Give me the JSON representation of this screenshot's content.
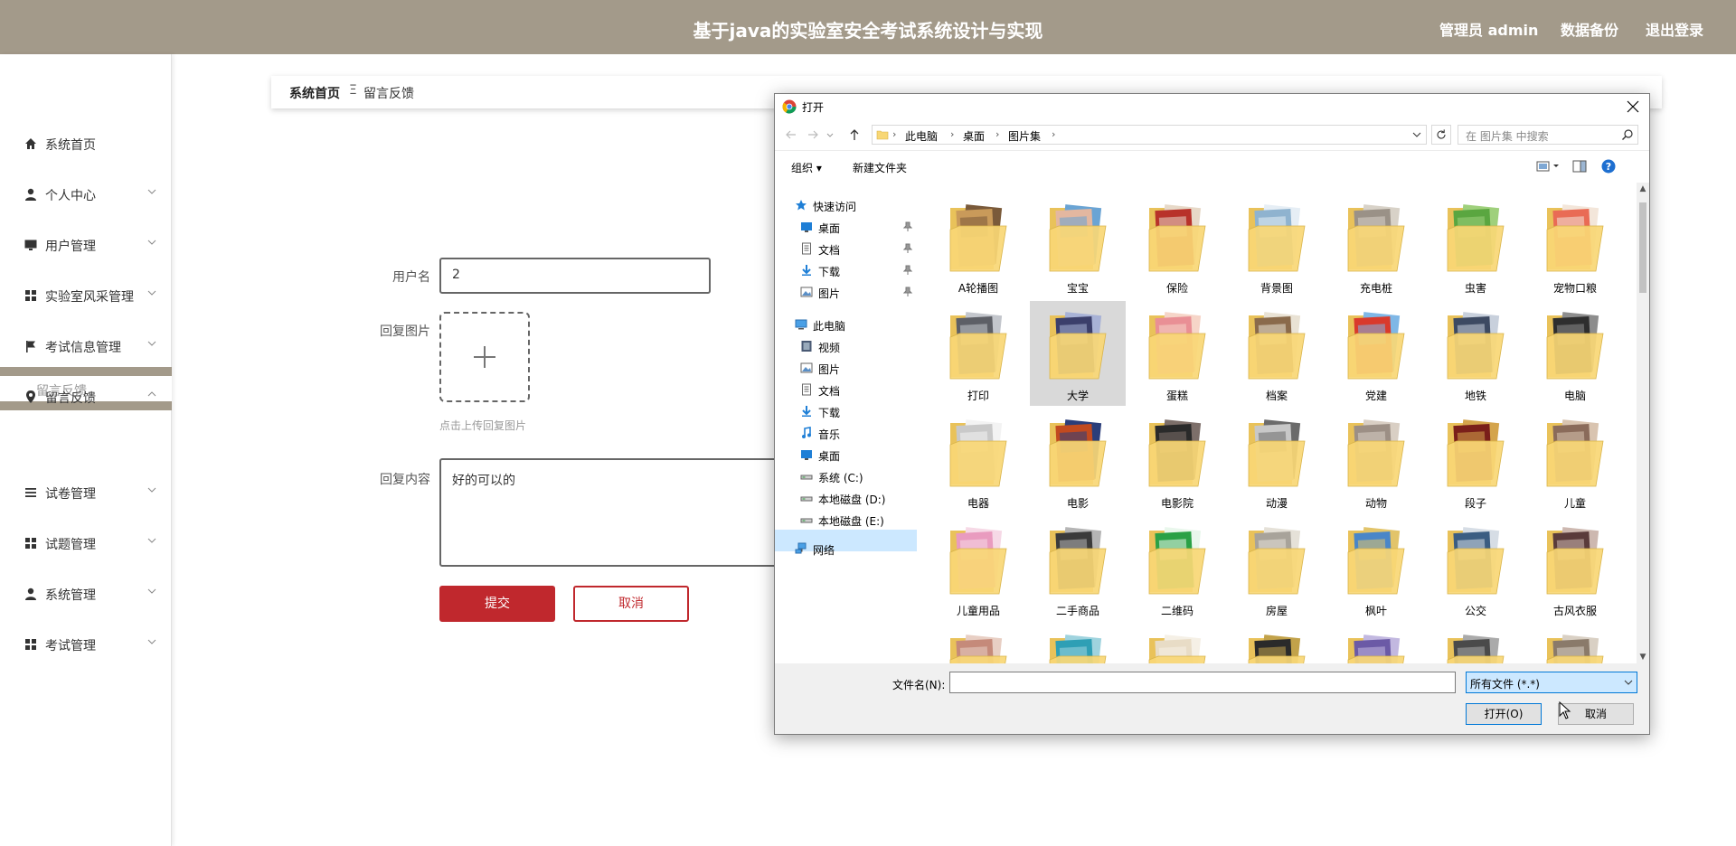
{
  "header": {
    "title": "基于java的实验室安全考试系统设计与实现",
    "admin_label": "管理员 admin",
    "backup_label": "数据备份",
    "logout_label": "退出登录"
  },
  "sidebar": {
    "items": [
      {
        "label": "系统首页",
        "icon": "home-icon"
      },
      {
        "label": "个人中心",
        "icon": "user-icon"
      },
      {
        "label": "用户管理",
        "icon": "monitor-icon"
      },
      {
        "label": "实验室风采管理",
        "icon": "grid-icon"
      },
      {
        "label": "考试信息管理",
        "icon": "flag-icon"
      },
      {
        "label": "留言反馈",
        "icon": "location-pin-icon"
      },
      {
        "label": "试卷管理",
        "icon": "list-icon"
      },
      {
        "label": "试题管理",
        "icon": "grid-icon"
      },
      {
        "label": "系统管理",
        "icon": "user-icon"
      },
      {
        "label": "考试管理",
        "icon": "grid-icon"
      }
    ],
    "active_sub": "留言反馈"
  },
  "breadcrumb": {
    "home": "系统首页",
    "separator": "Ξ",
    "current": "留言反馈"
  },
  "form": {
    "username_label": "用户名",
    "username_value": "2",
    "image_label": "回复图片",
    "upload_hint": "点击上传回复图片",
    "content_label": "回复内容",
    "content_value": "好的可以的",
    "submit_label": "提交",
    "cancel_label": "取消"
  },
  "dialog": {
    "title": "打开",
    "path": [
      "此电脑",
      "桌面",
      "图片集"
    ],
    "search_placeholder": "在 图片集 中搜索",
    "toolbar": {
      "organize": "组织 ▾",
      "new_folder": "新建文件夹"
    },
    "tree": [
      {
        "label": "快速访问",
        "icon": "star-icon",
        "level": 0,
        "pinned": false
      },
      {
        "label": "桌面",
        "icon": "desktop-icon",
        "level": 1,
        "pinned": true
      },
      {
        "label": "文档",
        "icon": "document-icon",
        "level": 1,
        "pinned": true
      },
      {
        "label": "下载",
        "icon": "download-icon",
        "level": 1,
        "pinned": true
      },
      {
        "label": "图片",
        "icon": "picture-icon",
        "level": 1,
        "pinned": true
      },
      {
        "label": "此电脑",
        "icon": "computer-icon",
        "level": 0,
        "pinned": false
      },
      {
        "label": "视频",
        "icon": "video-icon",
        "level": 1,
        "pinned": false
      },
      {
        "label": "图片",
        "icon": "picture-icon",
        "level": 1,
        "pinned": false
      },
      {
        "label": "文档",
        "icon": "document-icon",
        "level": 1,
        "pinned": false
      },
      {
        "label": "下载",
        "icon": "download-icon",
        "level": 1,
        "pinned": false
      },
      {
        "label": "音乐",
        "icon": "music-icon",
        "level": 1,
        "pinned": false
      },
      {
        "label": "桌面",
        "icon": "desktop-icon",
        "level": 1,
        "pinned": false
      },
      {
        "label": "系统 (C:)",
        "icon": "drive-icon",
        "level": 1,
        "pinned": false
      },
      {
        "label": "本地磁盘 (D:)",
        "icon": "drive-icon",
        "level": 1,
        "pinned": false
      },
      {
        "label": "本地磁盘 (E:)",
        "icon": "drive-icon",
        "level": 1,
        "pinned": false
      },
      {
        "label": "网络",
        "icon": "network-icon",
        "level": 0,
        "pinned": false
      }
    ],
    "selected_tree_item": "桌面",
    "folders": [
      {
        "name": "A轮播图",
        "c1": "#c99a5a",
        "c2": "#7a5a3a"
      },
      {
        "name": "宝宝",
        "c1": "#e3b7a0",
        "c2": "#6aa4d4"
      },
      {
        "name": "保险",
        "c1": "#b8322a",
        "c2": "#e7d9c8"
      },
      {
        "name": "背景图",
        "c1": "#8fb3cf",
        "c2": "#e6eef5"
      },
      {
        "name": "充电桩",
        "c1": "#9a9187",
        "c2": "#d8d2c8"
      },
      {
        "name": "虫害",
        "c1": "#5aa640",
        "c2": "#9fd07c"
      },
      {
        "name": "宠物口粮",
        "c1": "#e96b55",
        "c2": "#f3e6da"
      },
      {
        "name": "打印",
        "c1": "#5d5f66",
        "c2": "#c3c6cc"
      },
      {
        "name": "大学",
        "c1": "#3b3f6b",
        "c2": "#a8b2d6"
      },
      {
        "name": "蛋糕",
        "c1": "#e98f95",
        "c2": "#f6d5c8"
      },
      {
        "name": "档案",
        "c1": "#8a6a4b",
        "c2": "#e9e2d4"
      },
      {
        "name": "党建",
        "c1": "#d93a2c",
        "c2": "#7fb7e6"
      },
      {
        "name": "地铁",
        "c1": "#3d4a62",
        "c2": "#c8d0dc"
      },
      {
        "name": "电脑",
        "c1": "#2e2e2e",
        "c2": "#8d8d8d"
      },
      {
        "name": "电器",
        "c1": "#c9c9c9",
        "c2": "#f3f3f3"
      },
      {
        "name": "电影",
        "c1": "#c24a1f",
        "c2": "#2b3e7a"
      },
      {
        "name": "电影院",
        "c1": "#2a2a2a",
        "c2": "#7d6f6a"
      },
      {
        "name": "动漫",
        "c1": "#c8c8c8",
        "c2": "#6b6b6b"
      },
      {
        "name": "动物",
        "c1": "#9c8f85",
        "c2": "#d9cfc4"
      },
      {
        "name": "段子",
        "c1": "#7a1f1a",
        "c2": "#d4a44c"
      },
      {
        "name": "儿童",
        "c1": "#8a6b5a",
        "c2": "#d9c4b0"
      },
      {
        "name": "儿童用品",
        "c1": "#e99bbf",
        "c2": "#f6d9e6"
      },
      {
        "name": "二手商品",
        "c1": "#3b3b3b",
        "c2": "#b5b5b5"
      },
      {
        "name": "二维码",
        "c1": "#2aa146",
        "c2": "#e9f7ec"
      },
      {
        "name": "房屋",
        "c1": "#a8a39a",
        "c2": "#e5e1d8"
      },
      {
        "name": "枫叶",
        "c1": "#4a86c8",
        "c2": "#e2c46a"
      },
      {
        "name": "公交",
        "c1": "#3b5d82",
        "c2": "#d6dde5"
      },
      {
        "name": "古风衣服",
        "c1": "#5a3b3b",
        "c2": "#cdb8b0"
      },
      {
        "name": "",
        "c1": "#c58a7a",
        "c2": "#e8cfc4"
      },
      {
        "name": "",
        "c1": "#2e9fb5",
        "c2": "#9fd3de"
      },
      {
        "name": "",
        "c1": "#e8dcc6",
        "c2": "#f5f0e6"
      },
      {
        "name": "",
        "c1": "#2a2a2a",
        "c2": "#c2a24a"
      },
      {
        "name": "",
        "c1": "#6b5aa6",
        "c2": "#c2b8e0"
      },
      {
        "name": "",
        "c1": "#4a4a4a",
        "c2": "#aaaaaa"
      },
      {
        "name": "",
        "c1": "#8a7a6a",
        "c2": "#d9d0c4"
      }
    ],
    "selected_folder": "大学",
    "filename_label": "文件名(N):",
    "filename_value": "",
    "filetype_value": "所有文件 (*.*)",
    "open_label": "打开(O)",
    "cancel_label": "取消"
  }
}
